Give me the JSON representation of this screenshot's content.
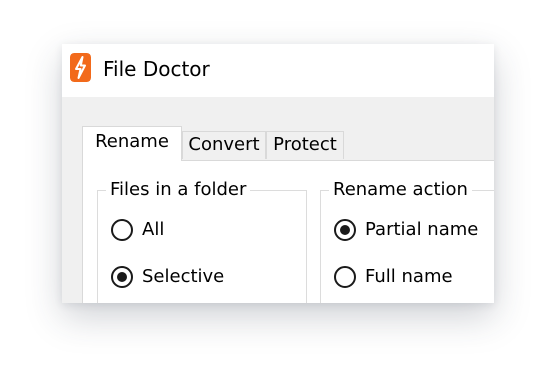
{
  "window": {
    "title": "File Doctor",
    "icon": "lightning-bolt-icon",
    "accent_color": "#f26a1b"
  },
  "tabs": [
    {
      "label": "Rename",
      "active": true
    },
    {
      "label": "Convert",
      "active": false
    },
    {
      "label": "Protect",
      "active": false
    }
  ],
  "files_group": {
    "legend": "Files in a folder",
    "options": [
      {
        "label": "All",
        "checked": false
      },
      {
        "label": "Selective",
        "checked": true
      }
    ]
  },
  "action_group": {
    "legend": "Rename action",
    "options": [
      {
        "label": "Partial name",
        "checked": true
      },
      {
        "label": "Full name",
        "checked": false
      }
    ]
  }
}
